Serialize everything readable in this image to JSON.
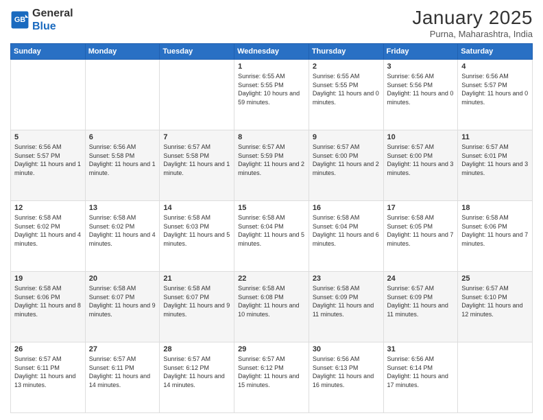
{
  "logo": {
    "line1": "General",
    "line2": "Blue"
  },
  "title": "January 2025",
  "location": "Purna, Maharashtra, India",
  "days_header": [
    "Sunday",
    "Monday",
    "Tuesday",
    "Wednesday",
    "Thursday",
    "Friday",
    "Saturday"
  ],
  "weeks": [
    [
      {
        "day": "",
        "content": ""
      },
      {
        "day": "",
        "content": ""
      },
      {
        "day": "",
        "content": ""
      },
      {
        "day": "1",
        "content": "Sunrise: 6:55 AM\nSunset: 5:55 PM\nDaylight: 10 hours and 59 minutes."
      },
      {
        "day": "2",
        "content": "Sunrise: 6:55 AM\nSunset: 5:55 PM\nDaylight: 11 hours and 0 minutes."
      },
      {
        "day": "3",
        "content": "Sunrise: 6:56 AM\nSunset: 5:56 PM\nDaylight: 11 hours and 0 minutes."
      },
      {
        "day": "4",
        "content": "Sunrise: 6:56 AM\nSunset: 5:57 PM\nDaylight: 11 hours and 0 minutes."
      }
    ],
    [
      {
        "day": "5",
        "content": "Sunrise: 6:56 AM\nSunset: 5:57 PM\nDaylight: 11 hours and 1 minute."
      },
      {
        "day": "6",
        "content": "Sunrise: 6:56 AM\nSunset: 5:58 PM\nDaylight: 11 hours and 1 minute."
      },
      {
        "day": "7",
        "content": "Sunrise: 6:57 AM\nSunset: 5:58 PM\nDaylight: 11 hours and 1 minute."
      },
      {
        "day": "8",
        "content": "Sunrise: 6:57 AM\nSunset: 5:59 PM\nDaylight: 11 hours and 2 minutes."
      },
      {
        "day": "9",
        "content": "Sunrise: 6:57 AM\nSunset: 6:00 PM\nDaylight: 11 hours and 2 minutes."
      },
      {
        "day": "10",
        "content": "Sunrise: 6:57 AM\nSunset: 6:00 PM\nDaylight: 11 hours and 3 minutes."
      },
      {
        "day": "11",
        "content": "Sunrise: 6:57 AM\nSunset: 6:01 PM\nDaylight: 11 hours and 3 minutes."
      }
    ],
    [
      {
        "day": "12",
        "content": "Sunrise: 6:58 AM\nSunset: 6:02 PM\nDaylight: 11 hours and 4 minutes."
      },
      {
        "day": "13",
        "content": "Sunrise: 6:58 AM\nSunset: 6:02 PM\nDaylight: 11 hours and 4 minutes."
      },
      {
        "day": "14",
        "content": "Sunrise: 6:58 AM\nSunset: 6:03 PM\nDaylight: 11 hours and 5 minutes."
      },
      {
        "day": "15",
        "content": "Sunrise: 6:58 AM\nSunset: 6:04 PM\nDaylight: 11 hours and 5 minutes."
      },
      {
        "day": "16",
        "content": "Sunrise: 6:58 AM\nSunset: 6:04 PM\nDaylight: 11 hours and 6 minutes."
      },
      {
        "day": "17",
        "content": "Sunrise: 6:58 AM\nSunset: 6:05 PM\nDaylight: 11 hours and 7 minutes."
      },
      {
        "day": "18",
        "content": "Sunrise: 6:58 AM\nSunset: 6:06 PM\nDaylight: 11 hours and 7 minutes."
      }
    ],
    [
      {
        "day": "19",
        "content": "Sunrise: 6:58 AM\nSunset: 6:06 PM\nDaylight: 11 hours and 8 minutes."
      },
      {
        "day": "20",
        "content": "Sunrise: 6:58 AM\nSunset: 6:07 PM\nDaylight: 11 hours and 9 minutes."
      },
      {
        "day": "21",
        "content": "Sunrise: 6:58 AM\nSunset: 6:07 PM\nDaylight: 11 hours and 9 minutes."
      },
      {
        "day": "22",
        "content": "Sunrise: 6:58 AM\nSunset: 6:08 PM\nDaylight: 11 hours and 10 minutes."
      },
      {
        "day": "23",
        "content": "Sunrise: 6:58 AM\nSunset: 6:09 PM\nDaylight: 11 hours and 11 minutes."
      },
      {
        "day": "24",
        "content": "Sunrise: 6:57 AM\nSunset: 6:09 PM\nDaylight: 11 hours and 11 minutes."
      },
      {
        "day": "25",
        "content": "Sunrise: 6:57 AM\nSunset: 6:10 PM\nDaylight: 11 hours and 12 minutes."
      }
    ],
    [
      {
        "day": "26",
        "content": "Sunrise: 6:57 AM\nSunset: 6:11 PM\nDaylight: 11 hours and 13 minutes."
      },
      {
        "day": "27",
        "content": "Sunrise: 6:57 AM\nSunset: 6:11 PM\nDaylight: 11 hours and 14 minutes."
      },
      {
        "day": "28",
        "content": "Sunrise: 6:57 AM\nSunset: 6:12 PM\nDaylight: 11 hours and 14 minutes."
      },
      {
        "day": "29",
        "content": "Sunrise: 6:57 AM\nSunset: 6:12 PM\nDaylight: 11 hours and 15 minutes."
      },
      {
        "day": "30",
        "content": "Sunrise: 6:56 AM\nSunset: 6:13 PM\nDaylight: 11 hours and 16 minutes."
      },
      {
        "day": "31",
        "content": "Sunrise: 6:56 AM\nSunset: 6:14 PM\nDaylight: 11 hours and 17 minutes."
      },
      {
        "day": "",
        "content": ""
      }
    ]
  ]
}
